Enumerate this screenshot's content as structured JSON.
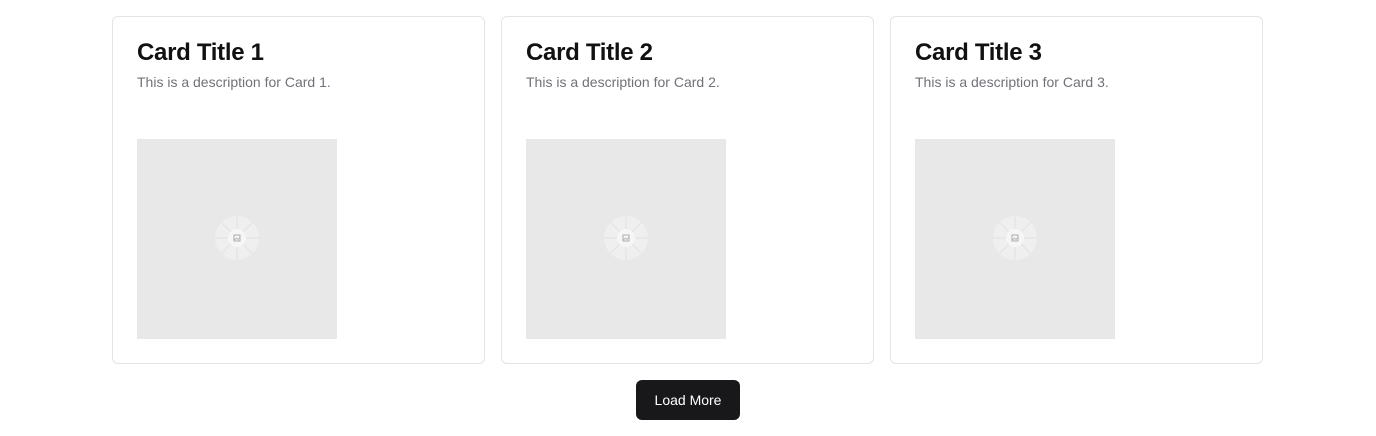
{
  "cards": [
    {
      "title": "Card Title 1",
      "description": "This is a description for Card 1.",
      "image_icon": "image-placeholder-icon"
    },
    {
      "title": "Card Title 2",
      "description": "This is a description for Card 2.",
      "image_icon": "image-placeholder-icon"
    },
    {
      "title": "Card Title 3",
      "description": "This is a description for Card 3.",
      "image_icon": "image-placeholder-icon"
    }
  ],
  "actions": {
    "load_more_label": "Load More"
  },
  "colors": {
    "button_bg": "#18181b",
    "image_bg": "#e8e8e8",
    "card_border": "#e4e4e7",
    "description_text": "#71717a"
  }
}
